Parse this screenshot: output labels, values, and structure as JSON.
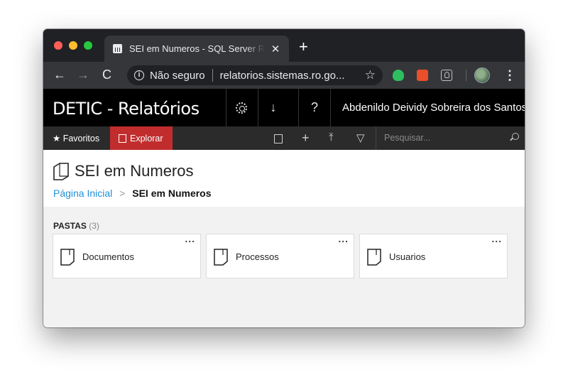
{
  "browser": {
    "tab_title": "SEI em Numeros - SQL Server Reporting Services",
    "tab_close": "✕",
    "new_tab": "+",
    "back": "←",
    "forward": "→",
    "reload": "C",
    "info": "i",
    "security_label": "Não seguro",
    "url": "relatorios.sistemas.ro.go...",
    "star": "☆",
    "menu": "⋮",
    "extensions": [
      "evernote-icon",
      "office-icon",
      "idea-icon"
    ]
  },
  "header": {
    "app_title": "DETIC - Relatórios",
    "download": "↓",
    "help": "?",
    "user_name": "Abdenildo Deividy Sobreira dos Santos"
  },
  "commandbar": {
    "favorites_icon": "★",
    "favorites": "Favoritos",
    "explore": "Explorar",
    "plus": "+",
    "upload": "⤒",
    "filter": "▽",
    "search_placeholder": "Pesquisar..."
  },
  "page": {
    "title": "SEI em Numeros",
    "breadcrumb_home": "Página Inicial",
    "breadcrumb_sep": ">",
    "breadcrumb_current": "SEI em Numeros"
  },
  "folders": {
    "section_label": "PASTAS",
    "count": "(3)",
    "menu": "...",
    "items": [
      {
        "label": "Documentos"
      },
      {
        "label": "Processos"
      },
      {
        "label": "Usuarios"
      }
    ]
  },
  "colors": {
    "accent_red": "#c12d2d",
    "link_blue": "#1f8fd6",
    "header_black": "#000000",
    "commandbar": "#2b2b2b"
  }
}
